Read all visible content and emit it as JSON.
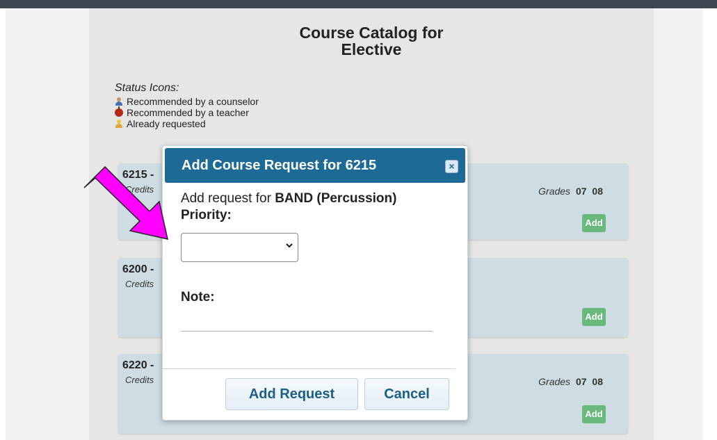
{
  "page": {
    "title_line1": "Course Catalog for",
    "title_line2": "Elective"
  },
  "status_icons": {
    "heading": "Status Icons:",
    "items": [
      {
        "icon": "counselor-icon",
        "label": "Recommended by a counselor"
      },
      {
        "icon": "apple-icon",
        "label": "Recommended by a teacher"
      },
      {
        "icon": "requested-icon",
        "label": "Already requested"
      }
    ]
  },
  "courses": [
    {
      "code": "6215 -",
      "credits": "Credits",
      "grades_label": "Grades",
      "grades": [
        "07",
        "08"
      ],
      "add_label": "Add"
    },
    {
      "code": "6200 -",
      "credits": "Credits",
      "add_label": "Add"
    },
    {
      "code": "6220 -",
      "credits": "Credits",
      "grades_label": "Grades",
      "grades": [
        "07",
        "08"
      ],
      "add_label": "Add"
    }
  ],
  "dialog": {
    "title": "Add Course Request for 6215",
    "close_label": "×",
    "request_prefix": "Add request for",
    "course_name": "BAND (Percussion)",
    "priority_label": "Priority:",
    "priority_value": "",
    "note_label": "Note:",
    "note_value": "",
    "add_request_label": "Add Request",
    "cancel_label": "Cancel"
  },
  "colors": {
    "dialog_header": "#1c6a95",
    "add_button": "#69b97c",
    "card_bg": "#cedde3",
    "annotation_arrow": "#ff00ff"
  }
}
